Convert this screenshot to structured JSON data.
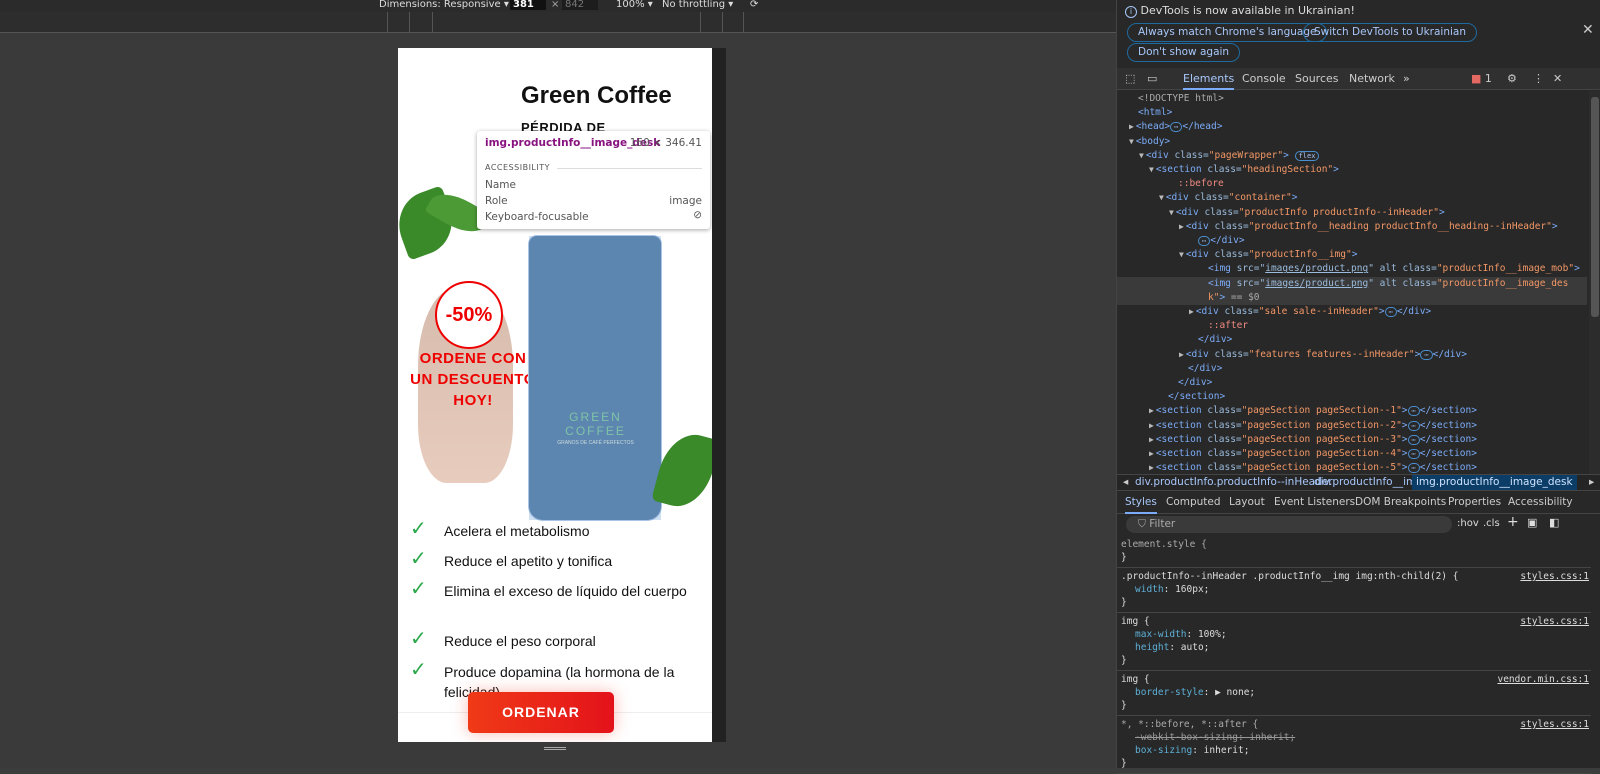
{
  "toolbar": {
    "dimensions": "Dimensions: Responsive ▾",
    "width": "381",
    "times": "×",
    "height": "842",
    "zoom": "100% ▾",
    "throttle": "No throttling ▾"
  },
  "page": {
    "title": "Green Coffee",
    "subtitle": "PÉRDIDA DE",
    "sale": "-50%",
    "promo": "ORDENE CON UN DESCUENTO HOY!",
    "can_label": "GREEN COFFEE",
    "can_sub": "GRANOS DE CAFÉ PERFECTOS",
    "features": [
      "Acelera el metabolismo",
      "Reduce el apetito y tonifica",
      "Elimina el exceso de líquido del cuerpo",
      "Reduce el peso corporal",
      "Produce dopamina (la hormona de la felicidad)"
    ],
    "cta": "ORDENAR",
    "accent": "#e3121a",
    "check_color": "#2aa84a"
  },
  "tooltip": {
    "selector": "img.productInfo__image_desk",
    "size": "160 × 346.41",
    "section": "ACCESSIBILITY",
    "rows": [
      {
        "k": "Name",
        "v": ""
      },
      {
        "k": "Role",
        "v": "image"
      },
      {
        "k": "Keyboard-focusable",
        "v": "⃠"
      }
    ]
  },
  "devtools": {
    "notice": "DevTools is now available in Ukrainian!",
    "btn_match": "Always match Chrome's language",
    "btn_switch": "Switch DevTools to Ukrainian",
    "btn_dont": "Don't show again",
    "tabs": [
      "Elements",
      "Console",
      "Sources",
      "Network",
      "»"
    ],
    "issues": "1",
    "tree": [
      {
        "i": 0,
        "s": [
          [
            "tx0",
            "<!DOCTYPE html>"
          ]
        ]
      },
      {
        "i": 0,
        "s": [
          [
            "tag",
            "<html>"
          ]
        ]
      },
      {
        "i": 0,
        "tri": "▶",
        "s": [
          [
            "tag",
            "<head>"
          ],
          [
            "badge",
            "⋯"
          ],
          [
            "tag",
            "</head>"
          ]
        ]
      },
      {
        "i": 0,
        "tri": "▼",
        "s": [
          [
            "tag",
            "<body>"
          ]
        ]
      },
      {
        "i": 1,
        "tri": "▼",
        "s": [
          [
            "tag",
            "<div "
          ],
          [
            "an",
            "class="
          ],
          [
            "av",
            "\"pageWrapper\""
          ],
          [
            "tag",
            "> "
          ],
          [
            "badge",
            "flex"
          ]
        ]
      },
      {
        "i": 2,
        "tri": "▼",
        "s": [
          [
            "tag",
            "<section "
          ],
          [
            "an",
            "class="
          ],
          [
            "av",
            "\"headingSection\""
          ],
          [
            "tag",
            ">"
          ]
        ]
      },
      {
        "i": 4,
        "s": [
          [
            "ps",
            "::before"
          ]
        ]
      },
      {
        "i": 3,
        "tri": "▼",
        "s": [
          [
            "tag",
            "<div "
          ],
          [
            "an",
            "class="
          ],
          [
            "av",
            "\"container\""
          ],
          [
            "tag",
            ">"
          ]
        ]
      },
      {
        "i": 4,
        "tri": "▼",
        "s": [
          [
            "tag",
            "<div "
          ],
          [
            "an",
            "class="
          ],
          [
            "av",
            "\"productInfo  productInfo--inHeader\""
          ],
          [
            "tag",
            ">"
          ]
        ]
      },
      {
        "i": 5,
        "tri": "▶",
        "s": [
          [
            "tag",
            "<div "
          ],
          [
            "an",
            "class="
          ],
          [
            "av",
            "\"productInfo__heading  productInfo__heading--inHeader\""
          ],
          [
            "tag",
            ">"
          ]
        ]
      },
      {
        "i": 6,
        "s": [
          [
            "badge",
            "⋯"
          ],
          [
            "tag",
            "</div>"
          ]
        ]
      },
      {
        "i": 5,
        "tri": "▼",
        "s": [
          [
            "tag",
            "<div "
          ],
          [
            "an",
            "class="
          ],
          [
            "av",
            "\"productInfo__img\""
          ],
          [
            "tag",
            ">"
          ]
        ]
      },
      {
        "i": 7,
        "s": [
          [
            "tag",
            "<img "
          ],
          [
            "an",
            "src="
          ],
          [
            "an",
            "\""
          ],
          [
            "link",
            "images/product.png"
          ],
          [
            "an",
            "\" alt class="
          ],
          [
            "av",
            "\"productInfo__image_mob\""
          ],
          [
            "tag",
            ">"
          ]
        ]
      },
      {
        "i": 7,
        "sel": true,
        "s": [
          [
            "tag",
            "<img "
          ],
          [
            "an",
            "src="
          ],
          [
            "an",
            "\""
          ],
          [
            "link",
            "images/product.png"
          ],
          [
            "an",
            "\" alt class="
          ],
          [
            "av",
            "\"productInfo__image_des"
          ]
        ]
      },
      {
        "i": 7,
        "sel": true,
        "s": [
          [
            "av",
            "k\""
          ],
          [
            "tag",
            ">"
          ],
          [
            "tx0",
            " == $0"
          ]
        ]
      },
      {
        "i": 6,
        "tri": "▶",
        "s": [
          [
            "tag",
            "<div "
          ],
          [
            "an",
            "class="
          ],
          [
            "av",
            "\"sale  sale--inHeader\""
          ],
          [
            "tag",
            ">"
          ],
          [
            "badge",
            "⋯"
          ],
          [
            "tag",
            "</div>"
          ]
        ]
      },
      {
        "i": 7,
        "s": [
          [
            "ps",
            "::after"
          ]
        ]
      },
      {
        "i": 6,
        "s": [
          [
            "tag",
            "</div>"
          ]
        ]
      },
      {
        "i": 5,
        "tri": "▶",
        "s": [
          [
            "tag",
            "<div "
          ],
          [
            "an",
            "class="
          ],
          [
            "av",
            "\"features  features--inHeader\""
          ],
          [
            "tag",
            ">"
          ],
          [
            "badge",
            "⋯"
          ],
          [
            "tag",
            "</div>"
          ]
        ]
      },
      {
        "i": 5,
        "s": [
          [
            "tag",
            "</div>"
          ]
        ]
      },
      {
        "i": 4,
        "s": [
          [
            "tag",
            "</div>"
          ]
        ]
      },
      {
        "i": 3,
        "s": [
          [
            "tag",
            "</section>"
          ]
        ]
      },
      {
        "i": 2,
        "tri": "▶",
        "s": [
          [
            "tag",
            "<section "
          ],
          [
            "an",
            "class="
          ],
          [
            "av",
            "\"pageSection pageSection--1\""
          ],
          [
            "tag",
            ">"
          ],
          [
            "badge",
            "⋯"
          ],
          [
            "tag",
            "</section>"
          ]
        ]
      },
      {
        "i": 2,
        "tri": "▶",
        "s": [
          [
            "tag",
            "<section "
          ],
          [
            "an",
            "class="
          ],
          [
            "av",
            "\"pageSection pageSection--2\""
          ],
          [
            "tag",
            ">"
          ],
          [
            "badge",
            "⋯"
          ],
          [
            "tag",
            "</section>"
          ]
        ]
      },
      {
        "i": 2,
        "tri": "▶",
        "s": [
          [
            "tag",
            "<section "
          ],
          [
            "an",
            "class="
          ],
          [
            "av",
            "\"pageSection pageSection--3\""
          ],
          [
            "tag",
            ">"
          ],
          [
            "badge",
            "⋯"
          ],
          [
            "tag",
            "</section>"
          ]
        ]
      },
      {
        "i": 2,
        "tri": "▶",
        "s": [
          [
            "tag",
            "<section "
          ],
          [
            "an",
            "class="
          ],
          [
            "av",
            "\"pageSection pageSection--4\""
          ],
          [
            "tag",
            ">"
          ],
          [
            "badge",
            "⋯"
          ],
          [
            "tag",
            "</section>"
          ]
        ]
      },
      {
        "i": 2,
        "tri": "▶",
        "s": [
          [
            "tag",
            "<section "
          ],
          [
            "an",
            "class="
          ],
          [
            "av",
            "\"pageSection pageSection--5\""
          ],
          [
            "tag",
            ">"
          ],
          [
            "badge",
            "⋯"
          ],
          [
            "tag",
            "</section>"
          ]
        ]
      }
    ],
    "crumbs": [
      "div.productInfo.productInfo--inHeader",
      "div.productInfo__img",
      "img.productInfo__image_desk"
    ],
    "style_tabs": [
      "Styles",
      "Computed",
      "Layout",
      "Event Listeners",
      "DOM Breakpoints",
      "Properties",
      "Accessibility"
    ],
    "filter": "Filter",
    "hov": ":hov",
    "cls": ".cls",
    "rules": [
      {
        "sel": "element.style {",
        "src": "",
        "props": []
      },
      {
        "sel": ".productInfo--inHeader .productInfo__img img:nth-child(2) {",
        "src": "styles.css:1",
        "props": [
          [
            "width",
            "160px;",
            false
          ]
        ]
      },
      {
        "sel": "img {",
        "src": "styles.css:1",
        "props": [
          [
            "max-width",
            "100%;",
            false
          ],
          [
            "height",
            "auto;",
            false
          ]
        ]
      },
      {
        "sel": "img {",
        "src": "vendor.min.css:1",
        "props": [
          [
            "border-style",
            "▶ none;",
            false
          ]
        ]
      },
      {
        "sel": "*, *::before, *::after {",
        "src": "styles.css:1",
        "props": [
          [
            "-webkit-box-sizing",
            "inherit;",
            true
          ],
          [
            "box-sizing",
            "inherit;",
            false
          ]
        ]
      }
    ]
  }
}
